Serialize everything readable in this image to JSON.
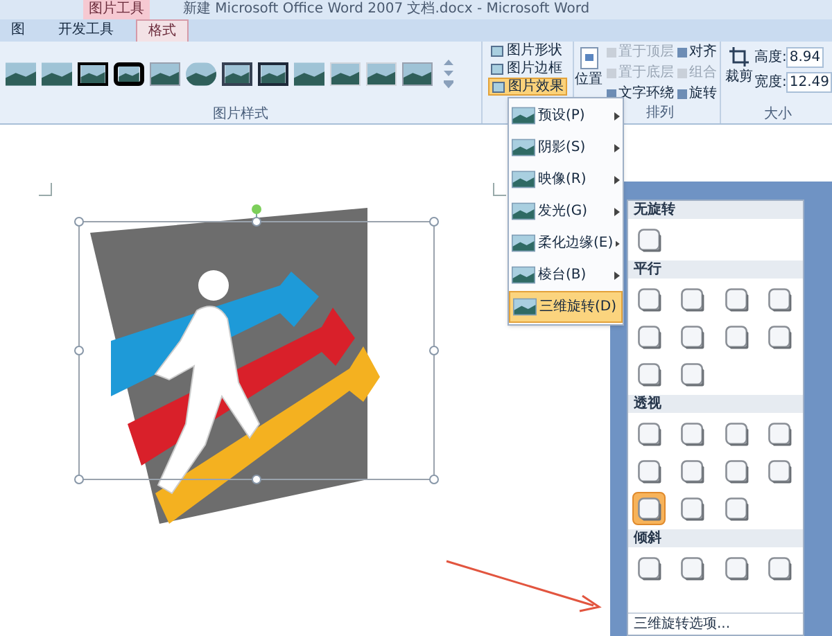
{
  "window": {
    "title": "新建 Microsoft Office Word 2007 文档.docx - Microsoft Word",
    "context_tab": "图片工具"
  },
  "tabs": [
    {
      "label": "图",
      "selected": false
    },
    {
      "label": "开发工具",
      "selected": false
    },
    {
      "label": "格式",
      "selected": true
    }
  ],
  "ribbon": {
    "picture_styles_label": "图片样式",
    "picture_commands": [
      {
        "label": "图片形状",
        "selected": false
      },
      {
        "label": "图片边框",
        "selected": false
      },
      {
        "label": "图片效果",
        "selected": true
      }
    ],
    "position_button": "位置",
    "arrange_buttons": [
      {
        "label": "置于顶层",
        "disabled": true
      },
      {
        "label": "对齐",
        "disabled": false
      },
      {
        "label": "置于底层",
        "disabled": true
      },
      {
        "label": "组合",
        "disabled": true
      },
      {
        "label": "文字环绕",
        "disabled": false
      },
      {
        "label": "旋转",
        "disabled": false
      }
    ],
    "arrange_label": "排列",
    "crop_button": "裁剪",
    "size_fields": [
      {
        "label": "高度:",
        "value": "8.94"
      },
      {
        "label": "宽度:",
        "value": "12.49"
      }
    ],
    "size_label": "大小"
  },
  "effects_menu": [
    {
      "label": "预设(P)",
      "selected": false
    },
    {
      "label": "阴影(S)",
      "selected": false
    },
    {
      "label": "映像(R)",
      "selected": false
    },
    {
      "label": "发光(G)",
      "selected": false
    },
    {
      "label": "柔化边缘(E)",
      "selected": false
    },
    {
      "label": "棱台(B)",
      "selected": false
    },
    {
      "label": "三维旋转(D)",
      "selected": true
    }
  ],
  "rotation_gallery": {
    "sections": [
      {
        "title": "无旋转",
        "items": [
          {
            "selected": false
          }
        ]
      },
      {
        "title": "平行",
        "items": [
          {
            "selected": false
          },
          {
            "selected": false
          },
          {
            "selected": false
          },
          {
            "selected": false
          },
          {
            "selected": false
          },
          {
            "selected": false
          },
          {
            "selected": false
          },
          {
            "selected": false
          },
          {
            "selected": false
          },
          {
            "selected": false
          }
        ]
      },
      {
        "title": "透视",
        "items": [
          {
            "selected": false
          },
          {
            "selected": false
          },
          {
            "selected": false
          },
          {
            "selected": false
          },
          {
            "selected": false
          },
          {
            "selected": false
          },
          {
            "selected": false
          },
          {
            "selected": false
          },
          {
            "selected": true
          },
          {
            "selected": false
          },
          {
            "selected": false
          }
        ]
      },
      {
        "title": "倾斜",
        "items": [
          {
            "selected": false
          },
          {
            "selected": false
          },
          {
            "selected": false
          },
          {
            "selected": false
          }
        ]
      }
    ],
    "footer": "三维旋转选项..."
  }
}
